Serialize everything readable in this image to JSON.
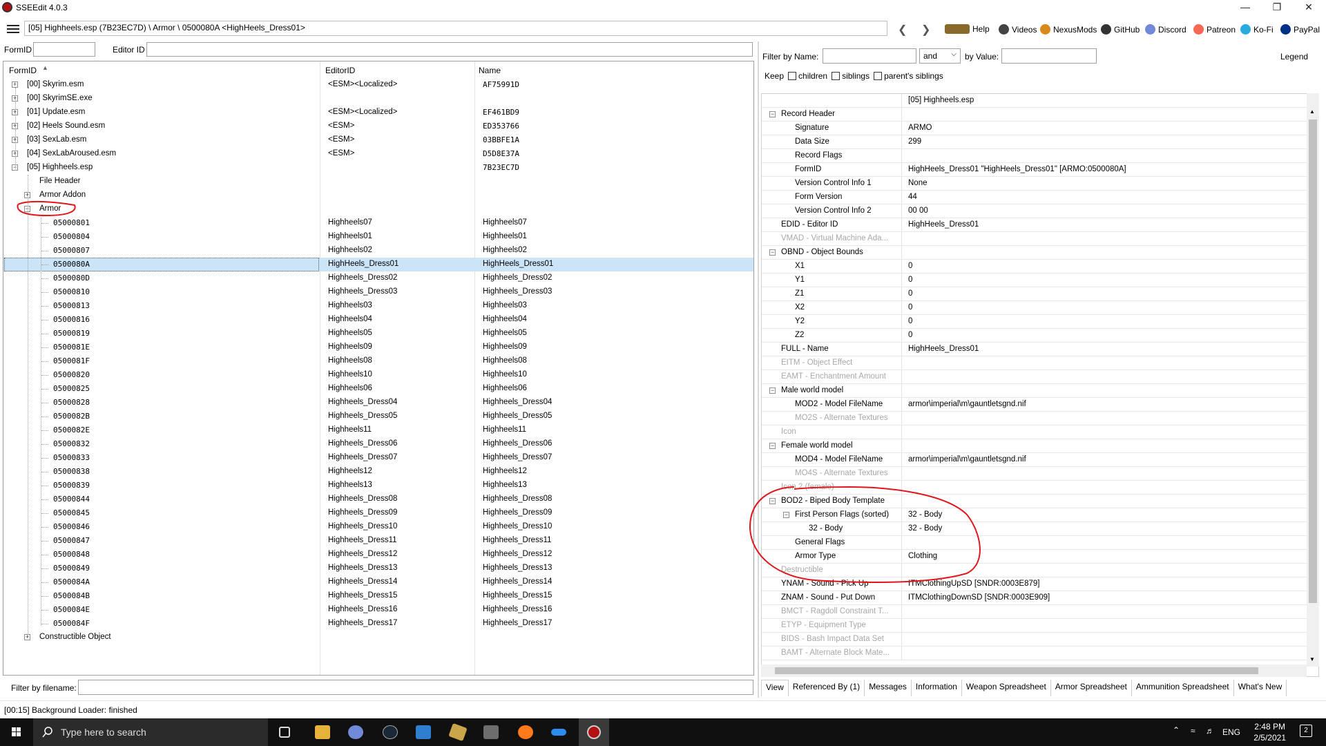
{
  "window": {
    "title": "SSEEdit 4.0.3"
  },
  "path": "[05] Highheels.esp (7B23EC7D) \\ Armor \\ 0500080A <HighHeels_Dress01>",
  "toplinks": [
    {
      "label": "Help",
      "icon": "book-icon",
      "color": "#8a6a2a"
    },
    {
      "label": "Videos",
      "icon": "video-icon",
      "color": "#444444"
    },
    {
      "label": "NexusMods",
      "icon": "nexus-icon",
      "color": "#d98a1a"
    },
    {
      "label": "GitHub",
      "icon": "github-icon",
      "color": "#333333"
    },
    {
      "label": "Discord",
      "icon": "discord-icon",
      "color": "#7289da"
    },
    {
      "label": "Patreon",
      "icon": "patreon-icon",
      "color": "#f96854"
    },
    {
      "label": "Ko-Fi",
      "icon": "kofi-icon",
      "color": "#29abe0"
    },
    {
      "label": "PayPal",
      "icon": "paypal-icon",
      "color": "#003087"
    }
  ],
  "left": {
    "formid_label": "FormID",
    "editorid_label": "Editor ID",
    "columns": [
      "FormID",
      "EditorID",
      "Name"
    ],
    "files": [
      {
        "label": "[00] Skyrim.esm",
        "editor": "<ESM><Localized>",
        "name": "AF75991D"
      },
      {
        "label": "[00] SkyrimSE.exe",
        "editor": "",
        "name": ""
      },
      {
        "label": "[01] Update.esm",
        "editor": "<ESM><Localized>",
        "name": "EF461BD9"
      },
      {
        "label": "[02] Heels Sound.esm",
        "editor": "<ESM>",
        "name": "ED353766"
      },
      {
        "label": "[03] SexLab.esm",
        "editor": "<ESM>",
        "name": "03BBFE1A"
      },
      {
        "label": "[04] SexLabAroused.esm",
        "editor": "<ESM>",
        "name": "D5D8E37A"
      },
      {
        "label": "[05] Highheels.esp",
        "editor": "",
        "name": "7B23EC7D"
      }
    ],
    "groups": {
      "file_header": "File Header",
      "armor_addon": "Armor Addon",
      "armor": "Armor",
      "constructible": "Constructible Object"
    },
    "armor_records": [
      {
        "id": "05000801",
        "editor": "Highheels07",
        "name": "Highheels07"
      },
      {
        "id": "05000804",
        "editor": "Highheels01",
        "name": "Highheels01"
      },
      {
        "id": "05000807",
        "editor": "Highheels02",
        "name": "Highheels02"
      },
      {
        "id": "0500080A",
        "editor": "HighHeels_Dress01",
        "name": "HighHeels_Dress01"
      },
      {
        "id": "0500080D",
        "editor": "Highheels_Dress02",
        "name": "Highheels_Dress02"
      },
      {
        "id": "05000810",
        "editor": "Highheels_Dress03",
        "name": "Highheels_Dress03"
      },
      {
        "id": "05000813",
        "editor": "Highheels03",
        "name": "Highheels03"
      },
      {
        "id": "05000816",
        "editor": "Highheels04",
        "name": "Highheels04"
      },
      {
        "id": "05000819",
        "editor": "Highheels05",
        "name": "Highheels05"
      },
      {
        "id": "0500081E",
        "editor": "Highheels09",
        "name": "Highheels09"
      },
      {
        "id": "0500081F",
        "editor": "Highheels08",
        "name": "Highheels08"
      },
      {
        "id": "05000820",
        "editor": "Highheels10",
        "name": "Highheels10"
      },
      {
        "id": "05000825",
        "editor": "Highheels06",
        "name": "Highheels06"
      },
      {
        "id": "05000828",
        "editor": "Highheels_Dress04",
        "name": "Highheels_Dress04"
      },
      {
        "id": "0500082B",
        "editor": "Highheels_Dress05",
        "name": "Highheels_Dress05"
      },
      {
        "id": "0500082E",
        "editor": "Highheels11",
        "name": "Highheels11"
      },
      {
        "id": "05000832",
        "editor": "Highheels_Dress06",
        "name": "Highheels_Dress06"
      },
      {
        "id": "05000833",
        "editor": "Highheels_Dress07",
        "name": "Highheels_Dress07"
      },
      {
        "id": "05000838",
        "editor": "Highheels12",
        "name": "Highheels12"
      },
      {
        "id": "05000839",
        "editor": "Highheels13",
        "name": "Highheels13"
      },
      {
        "id": "05000844",
        "editor": "Highheels_Dress08",
        "name": "Highheels_Dress08"
      },
      {
        "id": "05000845",
        "editor": "Highheels_Dress09",
        "name": "Highheels_Dress09"
      },
      {
        "id": "05000846",
        "editor": "Highheels_Dress10",
        "name": "Highheels_Dress10"
      },
      {
        "id": "05000847",
        "editor": "Highheels_Dress11",
        "name": "Highheels_Dress11"
      },
      {
        "id": "05000848",
        "editor": "Highheels_Dress12",
        "name": "Highheels_Dress12"
      },
      {
        "id": "05000849",
        "editor": "Highheels_Dress13",
        "name": "Highheels_Dress13"
      },
      {
        "id": "0500084A",
        "editor": "Highheels_Dress14",
        "name": "Highheels_Dress14"
      },
      {
        "id": "0500084B",
        "editor": "Highheels_Dress15",
        "name": "Highheels_Dress15"
      },
      {
        "id": "0500084E",
        "editor": "Highheels_Dress16",
        "name": "Highheels_Dress16"
      },
      {
        "id": "0500084F",
        "editor": "Highheels_Dress17",
        "name": "Highheels_Dress17"
      }
    ],
    "selected_id": "0500080A",
    "filename_filter_label": "Filter by filename:"
  },
  "right": {
    "filter_name_label": "Filter by Name:",
    "and_label": "and",
    "by_value_label": "by Value:",
    "legend": "Legend",
    "keep_label": "Keep",
    "keep_children": "children",
    "keep_siblings": "siblings",
    "keep_parents": "parent's siblings",
    "header_value": "[05] Highheels.esp",
    "rows": [
      {
        "label": "Record Header",
        "value": "",
        "level": 0,
        "toggle": true,
        "dim": false
      },
      {
        "label": "Signature",
        "value": "ARMO",
        "level": 1,
        "toggle": false,
        "dim": false
      },
      {
        "label": "Data Size",
        "value": "299",
        "level": 1,
        "toggle": false,
        "dim": false
      },
      {
        "label": "Record Flags",
        "value": "",
        "level": 1,
        "toggle": false,
        "dim": false
      },
      {
        "label": "FormID",
        "value": "HighHeels_Dress01 \"HighHeels_Dress01\" [ARMO:0500080A]",
        "level": 1,
        "toggle": false,
        "dim": false
      },
      {
        "label": "Version Control Info 1",
        "value": "None",
        "level": 1,
        "toggle": false,
        "dim": false
      },
      {
        "label": "Form Version",
        "value": "44",
        "level": 1,
        "toggle": false,
        "dim": false
      },
      {
        "label": "Version Control Info 2",
        "value": "00 00",
        "level": 1,
        "toggle": false,
        "dim": false
      },
      {
        "label": "EDID - Editor ID",
        "value": "HighHeels_Dress01",
        "level": 0,
        "toggle": false,
        "dim": false
      },
      {
        "label": "VMAD - Virtual Machine Ada...",
        "value": "",
        "level": 0,
        "toggle": false,
        "dim": true
      },
      {
        "label": "OBND - Object Bounds",
        "value": "",
        "level": 0,
        "toggle": true,
        "dim": false
      },
      {
        "label": "X1",
        "value": "0",
        "level": 1,
        "toggle": false,
        "dim": false
      },
      {
        "label": "Y1",
        "value": "0",
        "level": 1,
        "toggle": false,
        "dim": false
      },
      {
        "label": "Z1",
        "value": "0",
        "level": 1,
        "toggle": false,
        "dim": false
      },
      {
        "label": "X2",
        "value": "0",
        "level": 1,
        "toggle": false,
        "dim": false
      },
      {
        "label": "Y2",
        "value": "0",
        "level": 1,
        "toggle": false,
        "dim": false
      },
      {
        "label": "Z2",
        "value": "0",
        "level": 1,
        "toggle": false,
        "dim": false
      },
      {
        "label": "FULL - Name",
        "value": "HighHeels_Dress01",
        "level": 0,
        "toggle": false,
        "dim": false
      },
      {
        "label": "EITM - Object Effect",
        "value": "",
        "level": 0,
        "toggle": false,
        "dim": true
      },
      {
        "label": "EAMT - Enchantment Amount",
        "value": "",
        "level": 0,
        "toggle": false,
        "dim": true
      },
      {
        "label": "Male world model",
        "value": "",
        "level": 0,
        "toggle": true,
        "dim": false
      },
      {
        "label": "MOD2 - Model FileName",
        "value": "armor\\imperial\\m\\gauntletsgnd.nif",
        "level": 1,
        "toggle": false,
        "dim": false
      },
      {
        "label": "MO2S - Alternate Textures",
        "value": "",
        "level": 1,
        "toggle": false,
        "dim": true
      },
      {
        "label": "Icon",
        "value": "",
        "level": 0,
        "toggle": false,
        "dim": true
      },
      {
        "label": "Female world model",
        "value": "",
        "level": 0,
        "toggle": true,
        "dim": false
      },
      {
        "label": "MOD4 - Model FileName",
        "value": "armor\\imperial\\m\\gauntletsgnd.nif",
        "level": 1,
        "toggle": false,
        "dim": false
      },
      {
        "label": "MO4S - Alternate Textures",
        "value": "",
        "level": 1,
        "toggle": false,
        "dim": true
      },
      {
        "label": "Icon 2 (female)",
        "value": "",
        "level": 0,
        "toggle": false,
        "dim": true
      },
      {
        "label": "BOD2 - Biped Body Template",
        "value": "",
        "level": 0,
        "toggle": true,
        "dim": false
      },
      {
        "label": "First Person Flags (sorted)",
        "value": "32 - Body",
        "level": 1,
        "toggle": true,
        "dim": false
      },
      {
        "label": "32 - Body",
        "value": "32 - Body",
        "level": 2,
        "toggle": false,
        "dim": false
      },
      {
        "label": "General Flags",
        "value": "",
        "level": 1,
        "toggle": false,
        "dim": false
      },
      {
        "label": "Armor Type",
        "value": "Clothing",
        "level": 1,
        "toggle": false,
        "dim": false
      },
      {
        "label": "Destructible",
        "value": "",
        "level": 0,
        "toggle": false,
        "dim": true
      },
      {
        "label": "YNAM - Sound - Pick Up",
        "value": "ITMClothingUpSD [SNDR:0003E879]",
        "level": 0,
        "toggle": false,
        "dim": false
      },
      {
        "label": "ZNAM - Sound - Put Down",
        "value": "ITMClothingDownSD [SNDR:0003E909]",
        "level": 0,
        "toggle": false,
        "dim": false
      },
      {
        "label": "BMCT - Ragdoll Constraint T...",
        "value": "",
        "level": 0,
        "toggle": false,
        "dim": true
      },
      {
        "label": "ETYP - Equipment Type",
        "value": "",
        "level": 0,
        "toggle": false,
        "dim": true
      },
      {
        "label": "BIDS - Bash Impact Data Set",
        "value": "",
        "level": 0,
        "toggle": false,
        "dim": true
      },
      {
        "label": "BAMT - Alternate Block Mate...",
        "value": "",
        "level": 0,
        "toggle": false,
        "dim": true
      }
    ],
    "tabs": [
      "View",
      "Referenced By (1)",
      "Messages",
      "Information",
      "Weapon Spreadsheet",
      "Armor Spreadsheet",
      "Ammunition Spreadsheet",
      "What's New"
    ]
  },
  "status": "[00:15] Background Loader: finished",
  "taskbar": {
    "search_placeholder": "Type here to search",
    "lang": "ENG",
    "time": "2:48 PM",
    "date": "2/5/2021",
    "notif_count": "2"
  },
  "annotation_color": "#e0161a"
}
